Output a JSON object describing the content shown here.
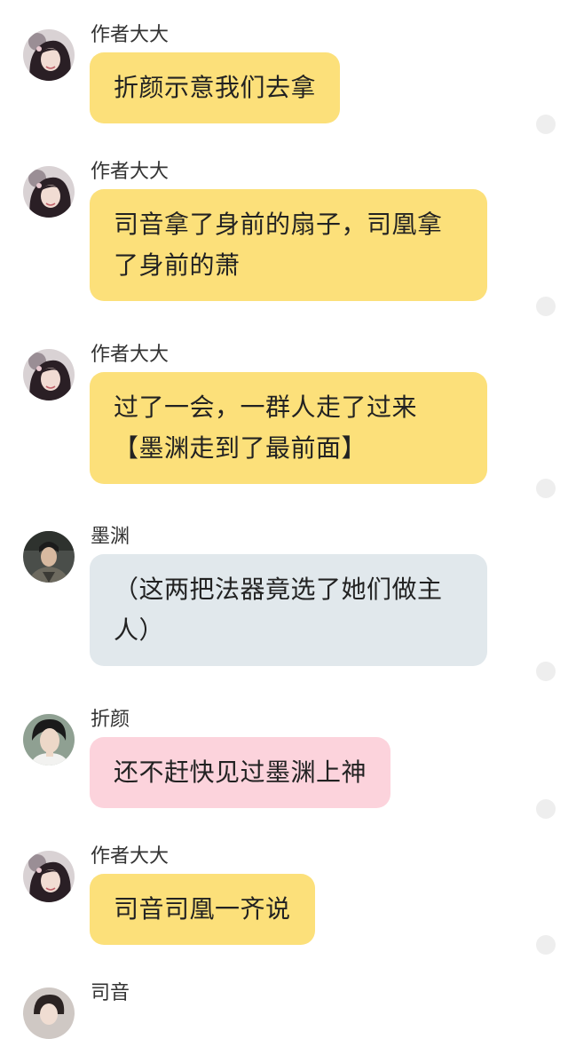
{
  "messages": [
    {
      "sender": "作者大大",
      "text": "折颜示意我们去拿",
      "avatar": "author-avatar",
      "bubble_color": "#fce07a"
    },
    {
      "sender": "作者大大",
      "text": "司音拿了身前的扇子，司凰拿了身前的萧",
      "avatar": "author-avatar",
      "bubble_color": "#fce07a"
    },
    {
      "sender": "作者大大",
      "text": "过了一会，一群人走了过来【墨渊走到了最前面】",
      "avatar": "author-avatar",
      "bubble_color": "#fce07a"
    },
    {
      "sender": "墨渊",
      "text": "（这两把法器竟选了她们做主人）",
      "avatar": "moyuan-avatar",
      "bubble_color": "#e1e8ec"
    },
    {
      "sender": "折颜",
      "text": "还不赶快见过墨渊上神",
      "avatar": "zheyan-avatar",
      "bubble_color": "#fcd3dc"
    },
    {
      "sender": "作者大大",
      "text": "司音司凰一齐说",
      "avatar": "author-avatar",
      "bubble_color": "#fce07a"
    },
    {
      "sender": "司音",
      "text": "",
      "avatar": "siyin-avatar"
    }
  ]
}
